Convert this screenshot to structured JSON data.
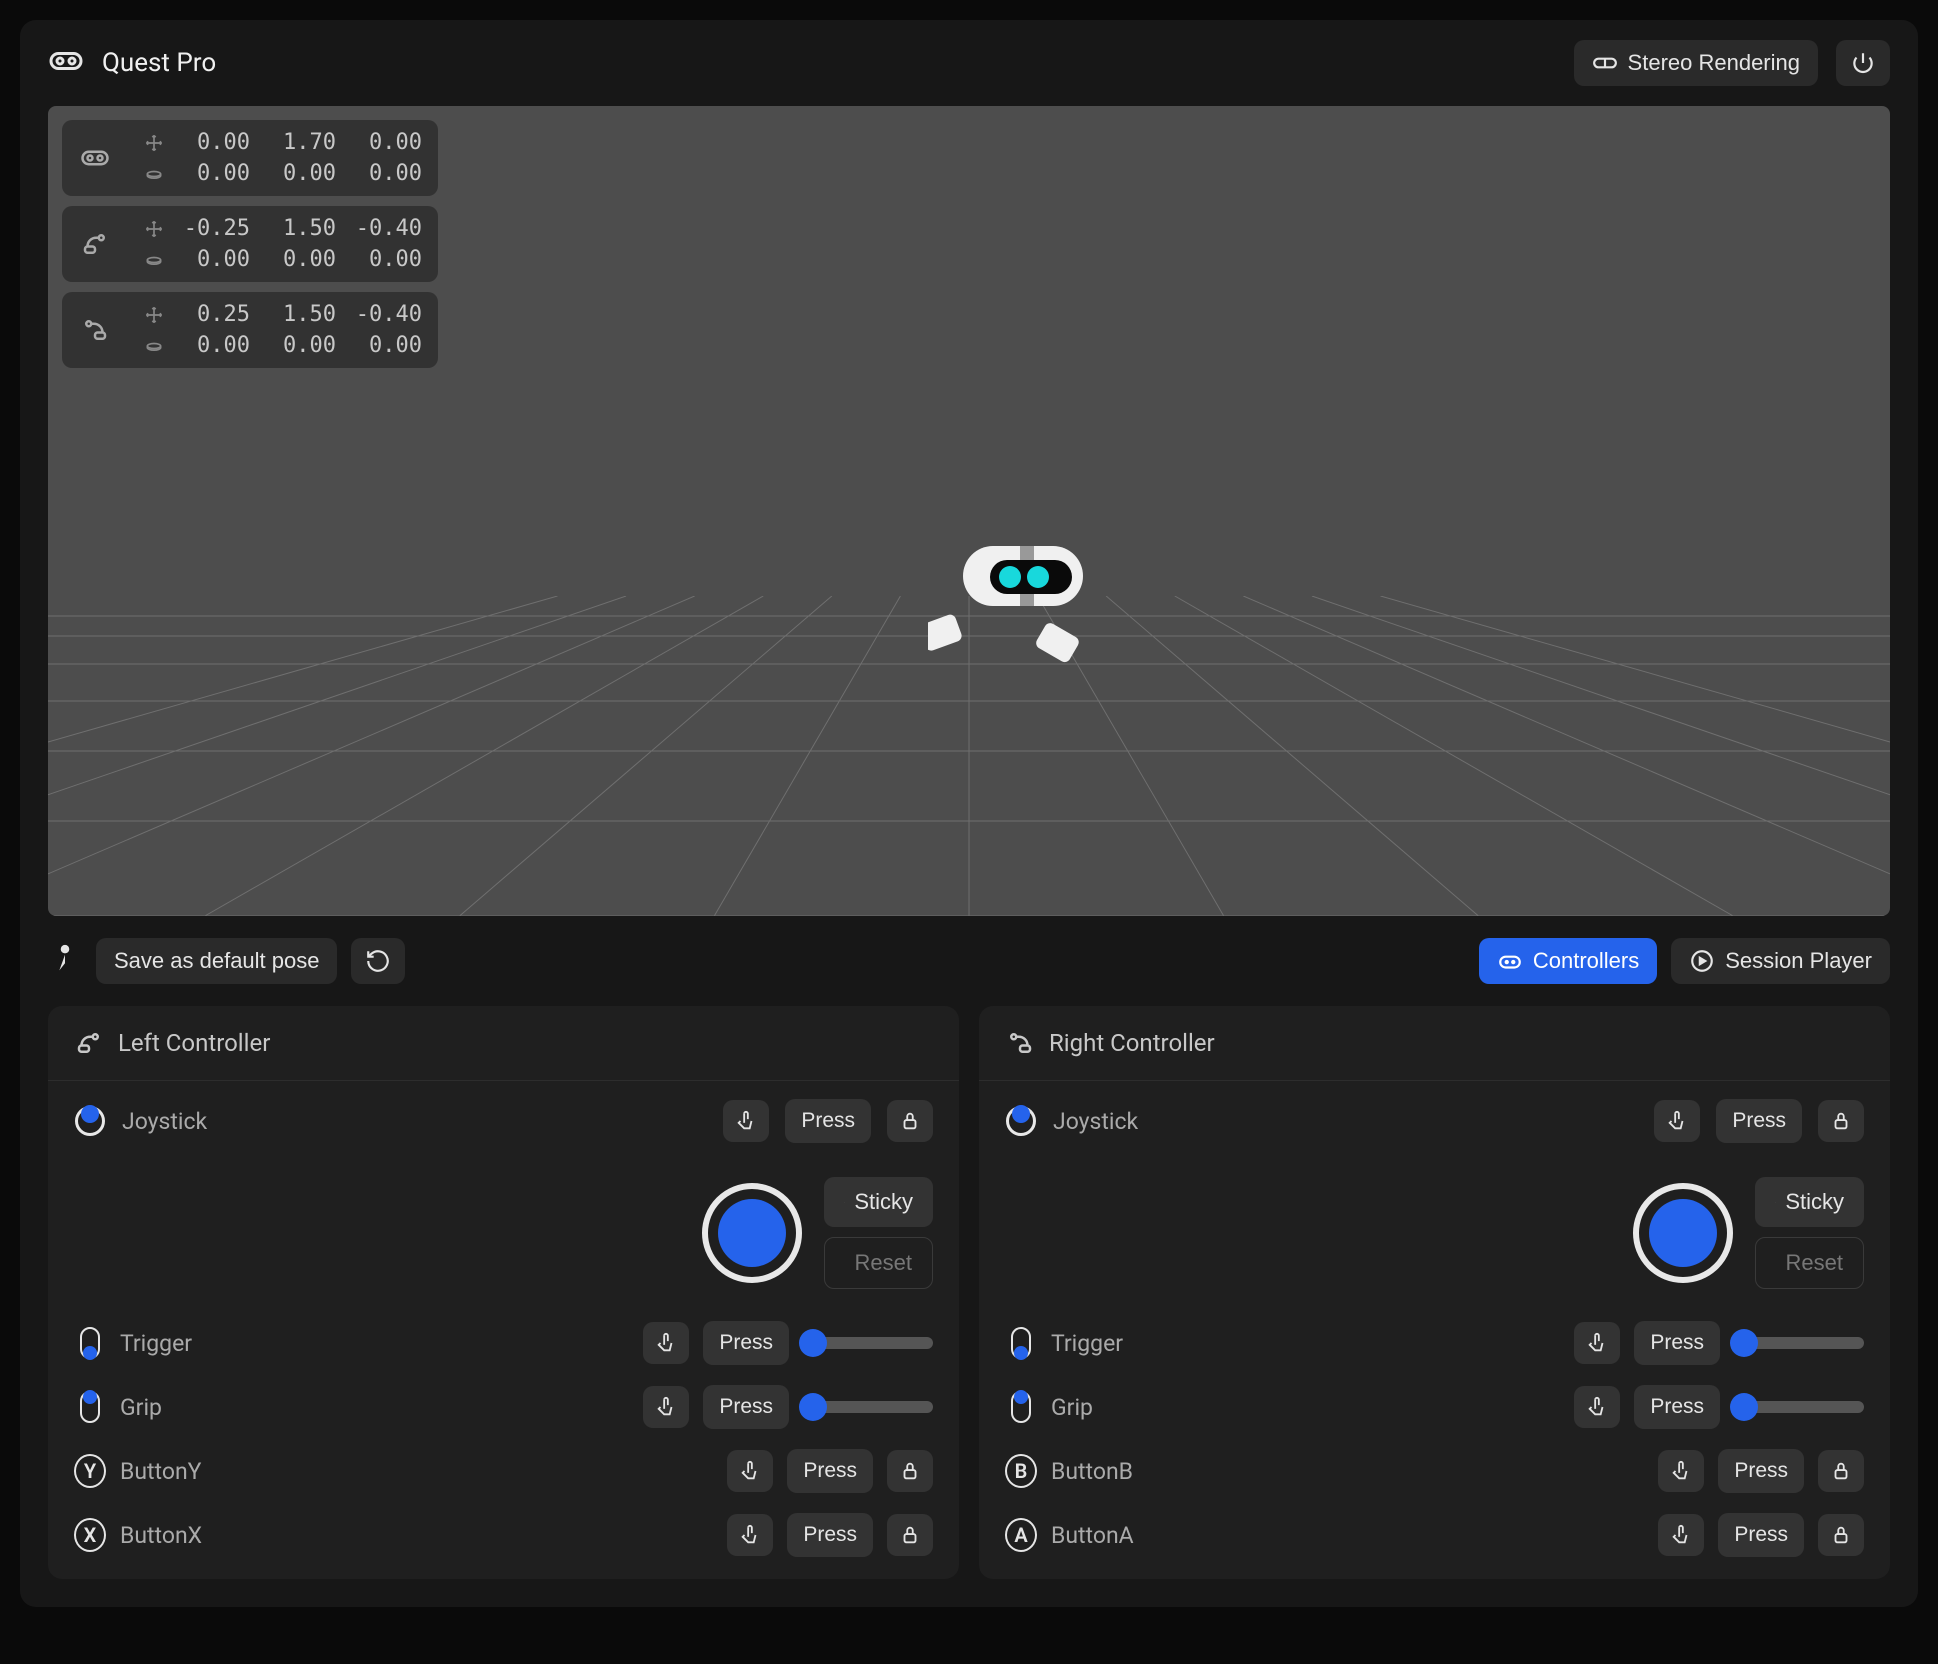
{
  "header": {
    "title": "Quest Pro",
    "stereo_label": "Stereo Rendering"
  },
  "stats": [
    {
      "icon": "headset",
      "pos": [
        "0.00",
        "1.70",
        "0.00"
      ],
      "rot": [
        "0.00",
        "0.00",
        "0.00"
      ]
    },
    {
      "icon": "left-ctrl",
      "pos": [
        "-0.25",
        "1.50",
        "-0.40"
      ],
      "rot": [
        "0.00",
        "0.00",
        "0.00"
      ]
    },
    {
      "icon": "right-ctrl",
      "pos": [
        "0.25",
        "1.50",
        "-0.40"
      ],
      "rot": [
        "0.00",
        "0.00",
        "0.00"
      ]
    }
  ],
  "toolbar": {
    "save_pose": "Save as default pose",
    "controllers": "Controllers",
    "session_player": "Session Player"
  },
  "controllers": {
    "left": {
      "title": "Left Controller",
      "joystick": "Joystick",
      "press": "Press",
      "sticky": "Sticky",
      "reset": "Reset",
      "trigger": "Trigger",
      "grip": "Grip",
      "btn1": "ButtonY",
      "btn1_letter": "Y",
      "btn2": "ButtonX",
      "btn2_letter": "X"
    },
    "right": {
      "title": "Right Controller",
      "joystick": "Joystick",
      "press": "Press",
      "sticky": "Sticky",
      "reset": "Reset",
      "trigger": "Trigger",
      "grip": "Grip",
      "btn1": "ButtonB",
      "btn1_letter": "B",
      "btn2": "ButtonA",
      "btn2_letter": "A"
    }
  }
}
